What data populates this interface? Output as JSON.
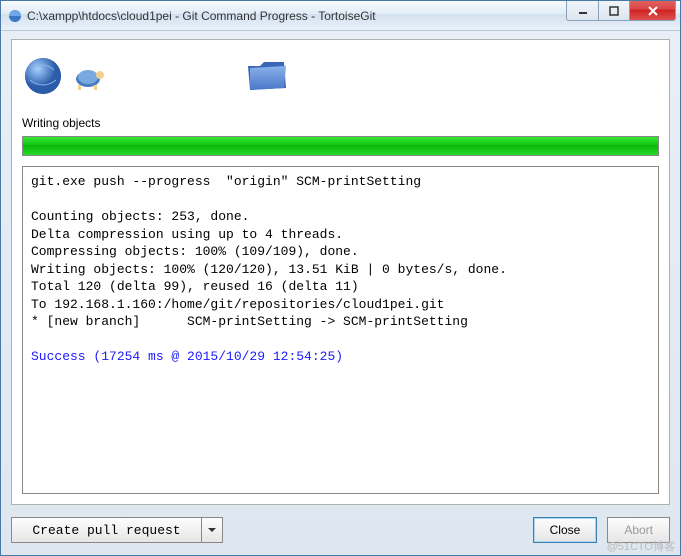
{
  "window": {
    "title": "C:\\xampp\\htdocs\\cloud1pei - Git Command Progress - TortoiseGit"
  },
  "status": {
    "label": "Writing objects"
  },
  "log": {
    "command": "git.exe push --progress  \"origin\" SCM-printSetting",
    "lines": [
      "Counting objects: 253, done.",
      "Delta compression using up to 4 threads.",
      "Compressing objects: 100% (109/109), done.",
      "Writing objects: 100% (120/120), 13.51 KiB | 0 bytes/s, done.",
      "Total 120 (delta 99), reused 16 (delta 11)",
      "To 192.168.1.160:/home/git/repositories/cloud1pei.git",
      "* [new branch]      SCM-printSetting -> SCM-printSetting"
    ],
    "success": "Success (17254 ms @ 2015/10/29 12:54:25)"
  },
  "footer": {
    "pull_request": "Create pull request",
    "close": "Close",
    "abort": "Abort"
  },
  "watermark": "@51CTO博客"
}
